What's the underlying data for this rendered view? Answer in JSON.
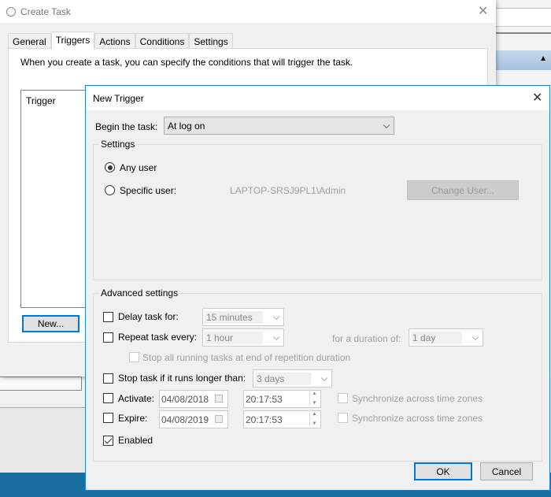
{
  "create_task": {
    "title": "Create Task",
    "tabs": [
      {
        "label": "General"
      },
      {
        "label": "Triggers",
        "active": true
      },
      {
        "label": "Actions"
      },
      {
        "label": "Conditions"
      },
      {
        "label": "Settings"
      }
    ],
    "description": "When you create a task, you can specify the conditions that will trigger the task.",
    "list_header": "Trigger",
    "new_button": "New..."
  },
  "new_trigger": {
    "title": "New Trigger",
    "begin_label": "Begin the task:",
    "begin_value": "At log on",
    "settings": {
      "label": "Settings",
      "any_user": "Any user",
      "specific_user": "Specific user:",
      "user_name": "LAPTOP-SRSJ9PL1\\Admin",
      "change_user": "Change User...",
      "selected": "Any user"
    },
    "advanced": {
      "label": "Advanced settings",
      "delay_label": "Delay task for:",
      "delay_value": "15 minutes",
      "delay_checked": false,
      "repeat_label": "Repeat task every:",
      "repeat_value": "1 hour",
      "repeat_checked": false,
      "duration_label": "for a duration of:",
      "duration_value": "1 day",
      "stop_all_label": "Stop all running tasks at end of repetition duration",
      "stop_label": "Stop task if it runs longer than:",
      "stop_value": "3 days",
      "stop_checked": false,
      "activate_label": "Activate:",
      "activate_date": "04/08/2018",
      "activate_time": "20:17:53",
      "expire_label": "Expire:",
      "expire_date": "04/08/2019",
      "expire_time": "20:17:53",
      "sync_label": "Synchronize across time zones",
      "enabled_label": "Enabled",
      "enabled_checked": true
    },
    "ok": "OK",
    "cancel": "Cancel"
  },
  "colors": {
    "accent": "#0078d7",
    "taskbar": "#1a6fa0",
    "header_band": "#b3cde6"
  }
}
